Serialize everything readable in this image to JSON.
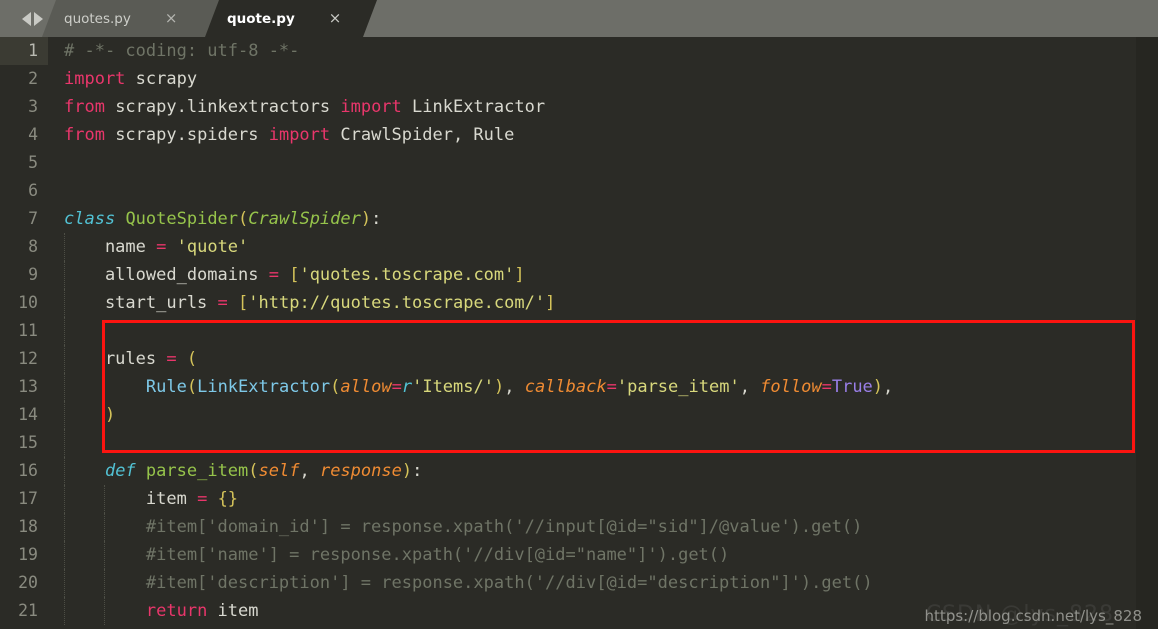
{
  "window": {
    "title": "quote.py",
    "nav": {
      "back_icon": "arrow-left-icon",
      "forward_icon": "arrow-right-icon"
    }
  },
  "tabs": [
    {
      "label": "quotes.py",
      "close_label": "×",
      "active": false
    },
    {
      "label": "quote.py",
      "close_label": "×",
      "active": true
    }
  ],
  "editor": {
    "language": "python",
    "current_line": 1,
    "total_lines_visible": 21,
    "theme": {
      "background": "#2b2b26",
      "tabbar_background": "#6d6e68",
      "gutter_text": "#8a8b80",
      "current_line_gutter": "#3b3b33",
      "keyword": "#e9366b",
      "declaration_keyword": "#52c2d4",
      "class_name": "#96c44b",
      "function_name": "#96c44b",
      "string": "#d8d87c",
      "bracket": "#d4c35a",
      "comment": "#6f7466",
      "parameter": "#ef8b33",
      "call": "#7ec9e8",
      "constant": "#9a7fe8",
      "default_text": "#d9d9d0"
    },
    "lines": [
      {
        "n": "1",
        "indent": 0,
        "tokens": [
          {
            "t": "# -*- coding: utf-8 -*-",
            "c": "cmt"
          }
        ]
      },
      {
        "n": "2",
        "indent": 0,
        "tokens": [
          {
            "t": "import",
            "c": "kw"
          },
          {
            "t": " ",
            "c": "punct"
          },
          {
            "t": "scrapy",
            "c": "name"
          }
        ]
      },
      {
        "n": "3",
        "indent": 0,
        "tokens": [
          {
            "t": "from",
            "c": "kw"
          },
          {
            "t": " scrapy.linkextractors ",
            "c": "name"
          },
          {
            "t": "import",
            "c": "kw"
          },
          {
            "t": " LinkExtractor",
            "c": "name"
          }
        ]
      },
      {
        "n": "4",
        "indent": 0,
        "tokens": [
          {
            "t": "from",
            "c": "kw"
          },
          {
            "t": " scrapy.spiders ",
            "c": "name"
          },
          {
            "t": "import",
            "c": "kw"
          },
          {
            "t": " CrawlSpider, Rule",
            "c": "name"
          }
        ]
      },
      {
        "n": "5",
        "indent": 0,
        "tokens": []
      },
      {
        "n": "6",
        "indent": 0,
        "tokens": []
      },
      {
        "n": "7",
        "indent": 0,
        "tokens": [
          {
            "t": "class",
            "c": "kwc"
          },
          {
            "t": " ",
            "c": "punct"
          },
          {
            "t": "QuoteSpider",
            "c": "cls"
          },
          {
            "t": "(",
            "c": "brk"
          },
          {
            "t": "CrawlSpider",
            "c": "clsi"
          },
          {
            "t": ")",
            "c": "brk"
          },
          {
            "t": ":",
            "c": "punct"
          }
        ]
      },
      {
        "n": "8",
        "indent": 1,
        "tokens": [
          {
            "t": "    name ",
            "c": "name"
          },
          {
            "t": "=",
            "c": "op"
          },
          {
            "t": " ",
            "c": "punct"
          },
          {
            "t": "'quote'",
            "c": "str"
          }
        ]
      },
      {
        "n": "9",
        "indent": 1,
        "tokens": [
          {
            "t": "    allowed_domains ",
            "c": "name"
          },
          {
            "t": "=",
            "c": "op"
          },
          {
            "t": " ",
            "c": "punct"
          },
          {
            "t": "[",
            "c": "brk"
          },
          {
            "t": "'quotes.toscrape.com'",
            "c": "str"
          },
          {
            "t": "]",
            "c": "brk"
          }
        ]
      },
      {
        "n": "10",
        "indent": 1,
        "tokens": [
          {
            "t": "    start_urls ",
            "c": "name"
          },
          {
            "t": "=",
            "c": "op"
          },
          {
            "t": " ",
            "c": "punct"
          },
          {
            "t": "[",
            "c": "brk"
          },
          {
            "t": "'http://quotes.toscrape.com/'",
            "c": "str"
          },
          {
            "t": "]",
            "c": "brk"
          }
        ]
      },
      {
        "n": "11",
        "indent": 1,
        "tokens": []
      },
      {
        "n": "12",
        "indent": 1,
        "tokens": [
          {
            "t": "    rules ",
            "c": "name"
          },
          {
            "t": "=",
            "c": "op"
          },
          {
            "t": " ",
            "c": "punct"
          },
          {
            "t": "(",
            "c": "brk"
          }
        ]
      },
      {
        "n": "13",
        "indent": 2,
        "tokens": [
          {
            "t": "        ",
            "c": "punct"
          },
          {
            "t": "Rule",
            "c": "call"
          },
          {
            "t": "(",
            "c": "brk"
          },
          {
            "t": "LinkExtractor",
            "c": "call"
          },
          {
            "t": "(",
            "c": "brk"
          },
          {
            "t": "allow",
            "c": "param"
          },
          {
            "t": "=",
            "c": "op"
          },
          {
            "t": "r",
            "c": "rpfx"
          },
          {
            "t": "'Items/'",
            "c": "str"
          },
          {
            "t": ")",
            "c": "brk"
          },
          {
            "t": ", ",
            "c": "punct"
          },
          {
            "t": "callback",
            "c": "param"
          },
          {
            "t": "=",
            "c": "op"
          },
          {
            "t": "'parse_item'",
            "c": "str"
          },
          {
            "t": ", ",
            "c": "punct"
          },
          {
            "t": "follow",
            "c": "param"
          },
          {
            "t": "=",
            "c": "op"
          },
          {
            "t": "True",
            "c": "const"
          },
          {
            "t": ")",
            "c": "brk"
          },
          {
            "t": ",",
            "c": "punct"
          }
        ]
      },
      {
        "n": "14",
        "indent": 1,
        "tokens": [
          {
            "t": "    ",
            "c": "punct"
          },
          {
            "t": ")",
            "c": "brk"
          }
        ]
      },
      {
        "n": "15",
        "indent": 1,
        "tokens": []
      },
      {
        "n": "16",
        "indent": 1,
        "tokens": [
          {
            "t": "    ",
            "c": "punct"
          },
          {
            "t": "def",
            "c": "kwc"
          },
          {
            "t": " ",
            "c": "punct"
          },
          {
            "t": "parse_item",
            "c": "fn"
          },
          {
            "t": "(",
            "c": "brk"
          },
          {
            "t": "self",
            "c": "param"
          },
          {
            "t": ", ",
            "c": "punct"
          },
          {
            "t": "response",
            "c": "param"
          },
          {
            "t": ")",
            "c": "brk"
          },
          {
            "t": ":",
            "c": "punct"
          }
        ]
      },
      {
        "n": "17",
        "indent": 2,
        "tokens": [
          {
            "t": "        item ",
            "c": "name"
          },
          {
            "t": "=",
            "c": "op"
          },
          {
            "t": " ",
            "c": "punct"
          },
          {
            "t": "{}",
            "c": "brk"
          }
        ]
      },
      {
        "n": "18",
        "indent": 2,
        "tokens": [
          {
            "t": "        #item['domain_id'] = response.xpath('//input[@id=\"sid\"]/@value').get()",
            "c": "cmt"
          }
        ]
      },
      {
        "n": "19",
        "indent": 2,
        "tokens": [
          {
            "t": "        #item['name'] = response.xpath('//div[@id=\"name\"]').get()",
            "c": "cmt"
          }
        ]
      },
      {
        "n": "20",
        "indent": 2,
        "tokens": [
          {
            "t": "        #item['description'] = response.xpath('//div[@id=\"description\"]').get()",
            "c": "cmt"
          }
        ]
      },
      {
        "n": "21",
        "indent": 2,
        "tokens": [
          {
            "t": "        ",
            "c": "punct"
          },
          {
            "t": "return",
            "c": "kw"
          },
          {
            "t": " item",
            "c": "name"
          }
        ]
      }
    ]
  },
  "annotation": {
    "type": "red-rectangle-highlight",
    "color": "#fc1410",
    "covers_lines": "12-14"
  },
  "watermark": {
    "text": "https://blog.csdn.net/lys_828",
    "ghost_text": "CSDN @lys_828"
  }
}
